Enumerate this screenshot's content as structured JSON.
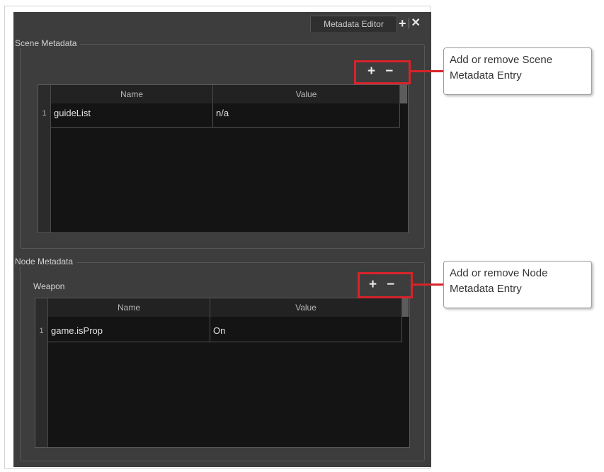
{
  "window": {
    "tab_title": "Metadata Editor"
  },
  "scene": {
    "group_title": "Scene Metadata",
    "columns": [
      "Name",
      "Value"
    ],
    "rows": [
      {
        "index": "1",
        "name": "guideList",
        "value": "n/a"
      }
    ]
  },
  "node": {
    "group_title": "Node Metadata",
    "node_name": "Weapon",
    "columns": [
      "Name",
      "Value"
    ],
    "rows": [
      {
        "index": "1",
        "name": "game.isProp",
        "value": "On"
      }
    ]
  },
  "buttons": {
    "add": "+",
    "remove": "−"
  },
  "callouts": {
    "scene": "Add or remove Scene Metadata Entry",
    "node": "Add or remove Node Metadata Entry"
  },
  "colors": {
    "highlight": "#d8232a",
    "panel": "#3d3d3d",
    "table": "#141414"
  }
}
